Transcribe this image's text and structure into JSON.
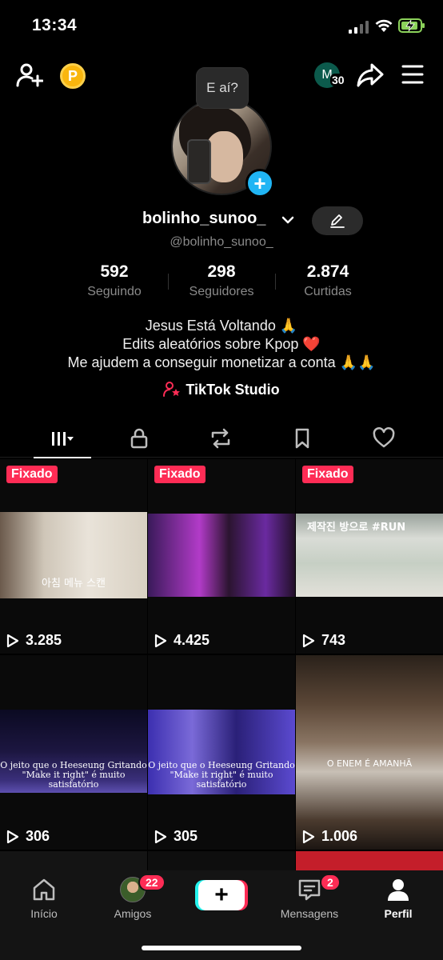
{
  "status_bar": {
    "time": "13:34"
  },
  "header": {
    "coin_label": "P",
    "avatar_letter": "M",
    "avatar_count": "30"
  },
  "profile": {
    "bubble_text": "E aí?",
    "username": "bolinho_sunoo_",
    "handle": "@bolinho_sunoo_",
    "stats": [
      {
        "value": "592",
        "label": "Seguindo"
      },
      {
        "value": "298",
        "label": "Seguidores"
      },
      {
        "value": "2.874",
        "label": "Curtidas"
      }
    ],
    "bio": [
      "Jesus Está Voltando 🙏",
      "Edits aleatórios sobre Kpop ❤️",
      "Me ajudem a conseguir monetizar a conta 🙏🙏"
    ],
    "studio_label": "TikTok Studio"
  },
  "tabs": [
    "videos",
    "private",
    "reposts",
    "saved",
    "liked"
  ],
  "videos": [
    {
      "pinned": "Fixado",
      "views": "3.285",
      "caption": "아침 메뉴 스캔"
    },
    {
      "pinned": "Fixado",
      "views": "4.425",
      "caption": ""
    },
    {
      "pinned": "Fixado",
      "views": "743",
      "caption": "제작진 방으로 #RUN"
    },
    {
      "pinned": "",
      "views": "306",
      "caption": "O jeito que o Heeseung Gritando \"Make it right\" é muito satisfatório"
    },
    {
      "pinned": "",
      "views": "305",
      "caption": "O jeito que o Heeseung Gritando \"Make it right\" é muito satisfatório"
    },
    {
      "pinned": "",
      "views": "1.006",
      "caption": "O ENEM É AMANHÃ"
    }
  ],
  "bottom_nav": {
    "home": "Início",
    "friends": "Amigos",
    "friends_badge": "22",
    "messages": "Mensagens",
    "messages_badge": "2",
    "profile": "Perfil"
  },
  "colors": {
    "accent": "#fe2c55",
    "cyan": "#25f4ee",
    "add_button": "#20b5f4"
  }
}
